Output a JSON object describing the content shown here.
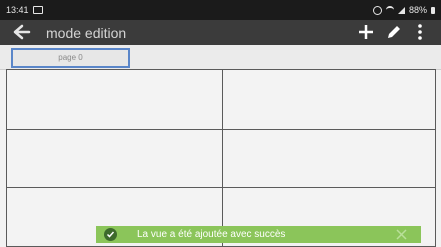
{
  "status_bar": {
    "time": "13:41",
    "battery": "88%",
    "icons": [
      "image-icon",
      "alarm-icon",
      "wifi-icon",
      "signal-icon",
      "battery-icon"
    ]
  },
  "app_bar": {
    "title": "mode edition",
    "icons": [
      "back-arrow-icon",
      "add-icon",
      "edit-pencil-icon",
      "more-vert-icon"
    ]
  },
  "tabs": [
    {
      "label": "page 0",
      "selected": true
    }
  ],
  "grid": {
    "rows": 3,
    "columns": 2
  },
  "snackbar": {
    "message": "La vue a été ajoutée avec succès",
    "color": "#8bc55a",
    "icons": [
      "check-circle-icon",
      "close-icon"
    ]
  }
}
